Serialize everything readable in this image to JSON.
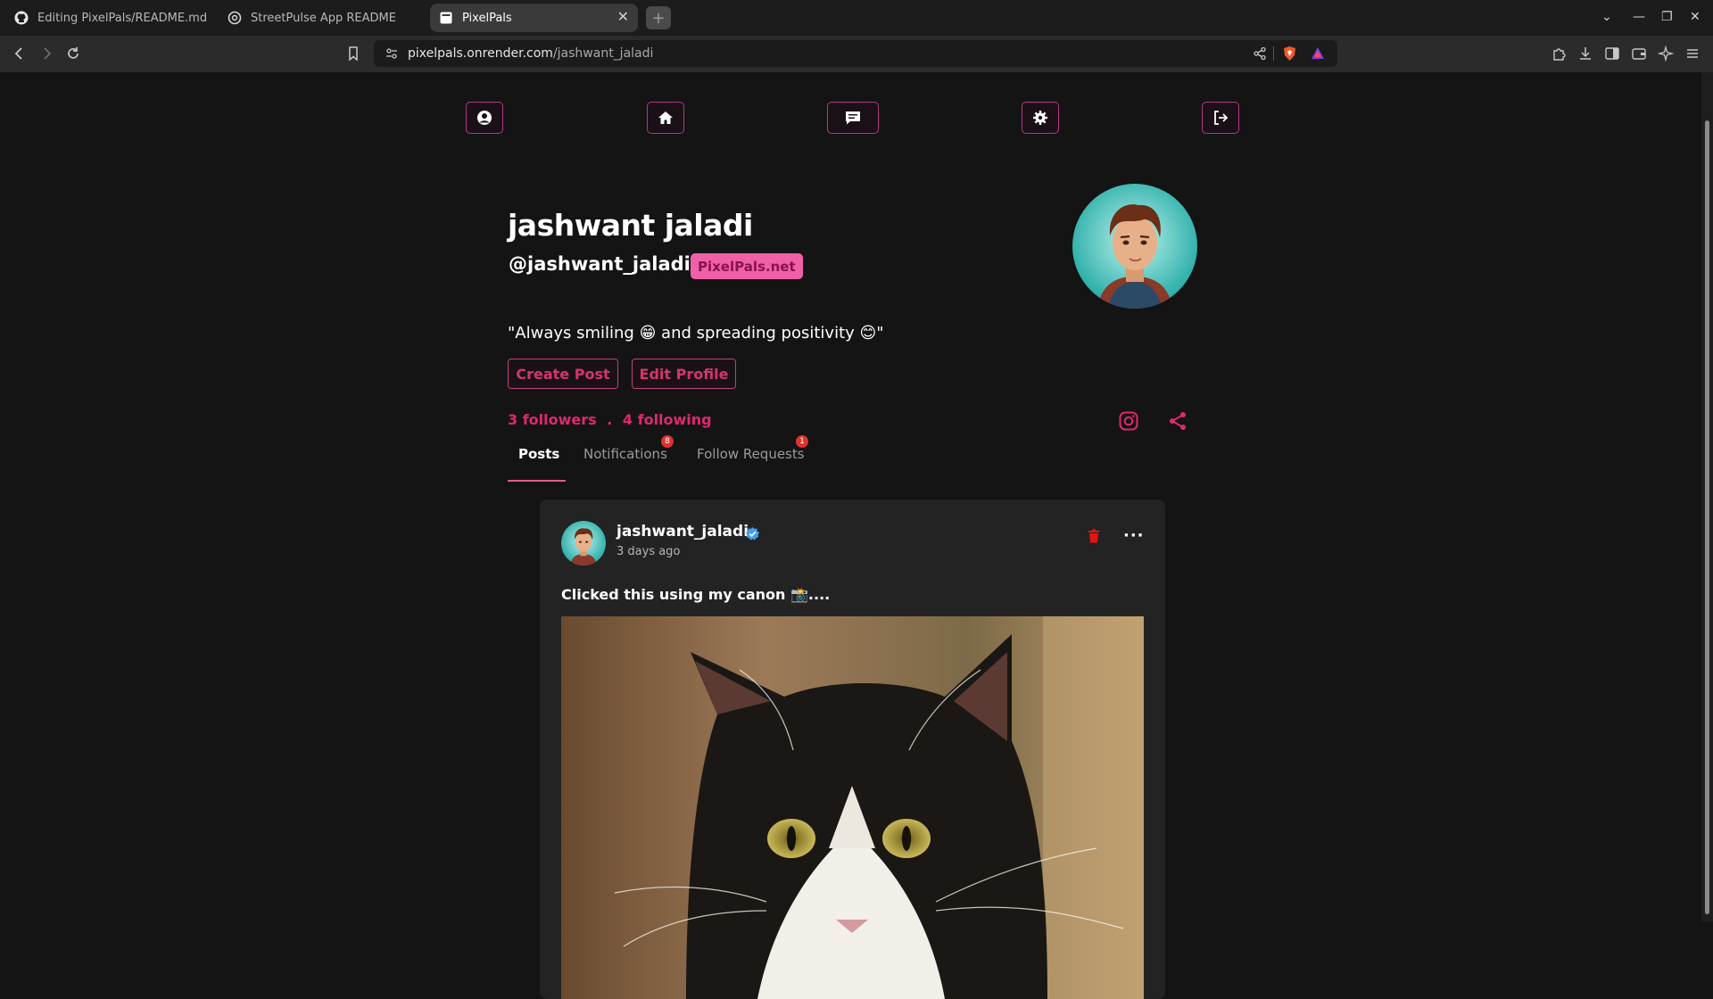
{
  "browser": {
    "tabs": [
      {
        "title": "Editing PixelPals/README.md at",
        "icon": "github-icon",
        "active": false
      },
      {
        "title": "StreetPulse App README",
        "icon": "chatgpt-icon",
        "active": false
      },
      {
        "title": "PixelPals",
        "icon": "page-icon",
        "active": true
      }
    ],
    "new_tab_label": "+",
    "url_host": "pixelpals.onrender.com",
    "url_path": "/jashwant_jaladi"
  },
  "nav": {
    "items": [
      "profile-icon",
      "home-icon",
      "chat-icon",
      "settings-icon",
      "logout-icon"
    ]
  },
  "profile": {
    "name": "jashwant jaladi",
    "handle": "@jashwant_jaladi",
    "badge": "PixelPals.net",
    "bio": "\"Always smiling 😁 and spreading positivity 😊\"",
    "create_post_label": "Create Post",
    "edit_profile_label": "Edit Profile",
    "followers": "3 followers",
    "separator": ".",
    "following": "4 following",
    "accent": "#e0286e"
  },
  "tabs": [
    {
      "label": "Posts",
      "active": true,
      "count": null
    },
    {
      "label": "Notifications",
      "active": false,
      "count": "8"
    },
    {
      "label": "Follow Requests",
      "active": false,
      "count": "1"
    }
  ],
  "post": {
    "username": "jashwant_jaladi",
    "time": "3 days ago",
    "caption": "Clicked this using my canon 📸....",
    "more_label": "···"
  }
}
